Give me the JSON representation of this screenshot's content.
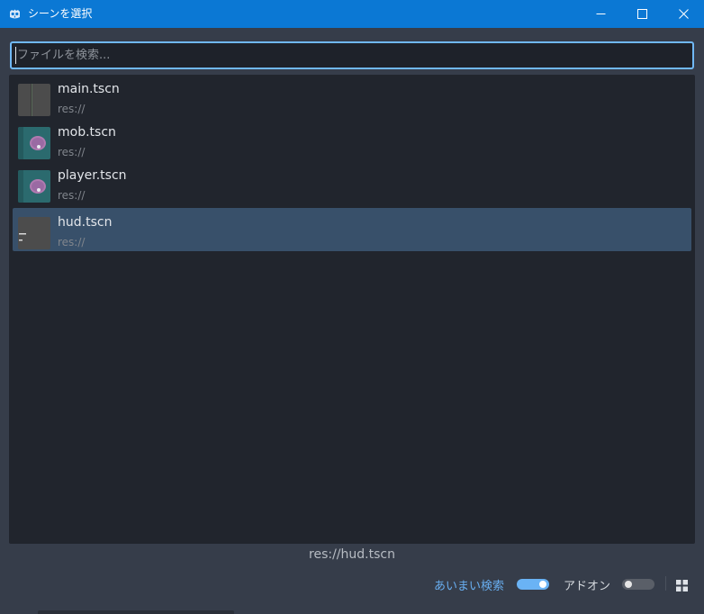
{
  "window": {
    "title": "シーンを選択",
    "app_icon": "godot-icon",
    "minimize_icon": "minimize-icon",
    "maximize_icon": "maximize-icon",
    "close_icon": "close-icon"
  },
  "search": {
    "value": "",
    "placeholder": "ファイルを検索..."
  },
  "files": [
    {
      "name": "main.tscn",
      "path": "res://",
      "thumbnail": "main-scene-thumbnail",
      "selected": false
    },
    {
      "name": "mob.tscn",
      "path": "res://",
      "thumbnail": "mob-scene-thumbnail",
      "selected": false
    },
    {
      "name": "player.tscn",
      "path": "res://",
      "thumbnail": "player-scene-thumbnail",
      "selected": false
    },
    {
      "name": "hud.tscn",
      "path": "res://",
      "thumbnail": "hud-scene-thumbnail",
      "selected": true
    }
  ],
  "footer": {
    "selected_path": "res://hud.tscn",
    "fuzzy_search_label": "あいまい検索",
    "fuzzy_search_enabled": true,
    "addons_label": "アドオン",
    "addons_enabled": false,
    "view_mode_icon": "grid-view-icon"
  },
  "colors": {
    "titlebar": "#0b78d4",
    "accent": "#70b8f5",
    "selection": "#38506a",
    "panel": "#21252d",
    "background": "#363d4a"
  }
}
